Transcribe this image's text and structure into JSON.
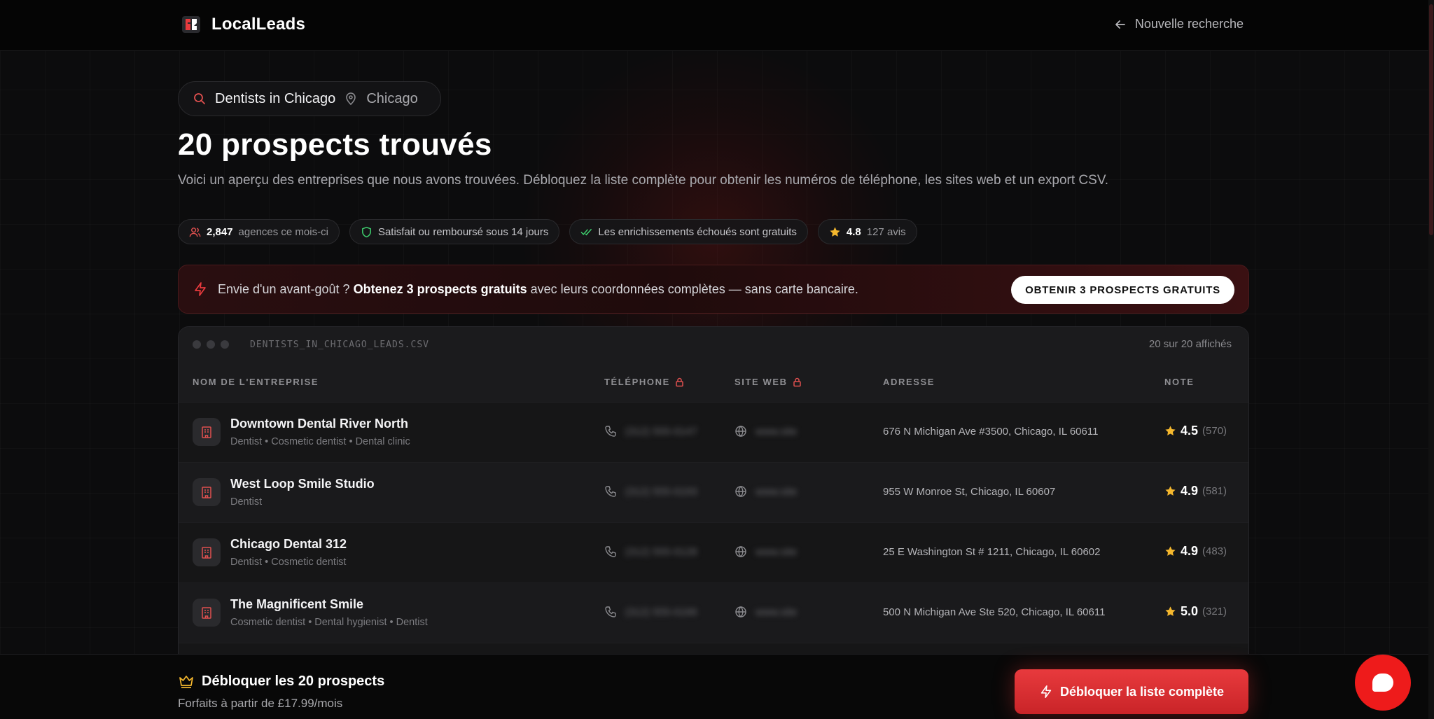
{
  "app": {
    "name": "LocalLeads",
    "new_search": "Nouvelle recherche"
  },
  "search": {
    "query": "Dentists in Chicago",
    "location": "Chicago"
  },
  "header": {
    "title": "20 prospects trouvés",
    "subtitle": "Voici un aperçu des entreprises que nous avons trouvées. Débloquez la liste complète pour obtenir les numéros de téléphone, les sites web et un export CSV."
  },
  "badges": {
    "agencies_count": "2,847",
    "agencies_label": "agences ce mois-ci",
    "refund": "Satisfait ou remboursé sous 14 jours",
    "enrich": "Les enrichissements échoués sont gratuits",
    "rating": "4.8",
    "reviews": "127 avis"
  },
  "promo": {
    "prefix": "Envie d'un avant-goût ? ",
    "bold": "Obtenez 3 prospects gratuits",
    "suffix": " avec leurs coordonnées complètes — sans carte bancaire.",
    "button": "OBTENIR 3 PROSPECTS GRATUITS"
  },
  "table": {
    "filename": "DENTISTS_IN_CHICAGO_LEADS.CSV",
    "shown": "20 sur 20 affichés",
    "columns": {
      "name": "NOM DE L'ENTREPRISE",
      "phone": "TÉLÉPHONE",
      "web": "SITE WEB",
      "address": "ADRESSE",
      "rating": "NOTE"
    },
    "rows": [
      {
        "name": "Downtown Dental River North",
        "categories": "Dentist • Cosmetic dentist • Dental clinic",
        "phone": "(312) 555-0147",
        "web": "www.site",
        "address": "676 N Michigan Ave #3500, Chicago, IL 60611",
        "score": "4.5",
        "count": "(570)"
      },
      {
        "name": "West Loop Smile Studio",
        "categories": "Dentist",
        "phone": "(312) 555-0193",
        "web": "www.site",
        "address": "955 W Monroe St, Chicago, IL 60607",
        "score": "4.9",
        "count": "(581)"
      },
      {
        "name": "Chicago Dental 312",
        "categories": "Dentist • Cosmetic dentist",
        "phone": "(312) 555-0128",
        "web": "www.site",
        "address": "25 E Washington St # 1211, Chicago, IL 60602",
        "score": "4.9",
        "count": "(483)"
      },
      {
        "name": "The Magnificent Smile",
        "categories": "Cosmetic dentist • Dental hygienist • Dentist",
        "phone": "(312) 555-0166",
        "web": "www.site",
        "address": "500 N Michigan Ave Ste 520, Chicago, IL 60611",
        "score": "5.0",
        "count": "(321)"
      }
    ]
  },
  "bottom": {
    "title": "Débloquer les 20 prospects",
    "subtitle": "Forfaits à partir de £17.99/mois",
    "button": "Débloquer la liste complète"
  },
  "colors": {
    "accent": "#e83a3d",
    "star": "#f5b82e",
    "success": "#3ecf6e"
  },
  "icons": [
    "logo-icon",
    "arrow-left-icon",
    "search-icon",
    "map-pin-icon",
    "users-icon",
    "shield-icon",
    "double-check-icon",
    "star-icon",
    "zap-icon",
    "lock-icon",
    "building-icon",
    "phone-icon",
    "globe-icon",
    "crown-icon",
    "chat-icon"
  ]
}
